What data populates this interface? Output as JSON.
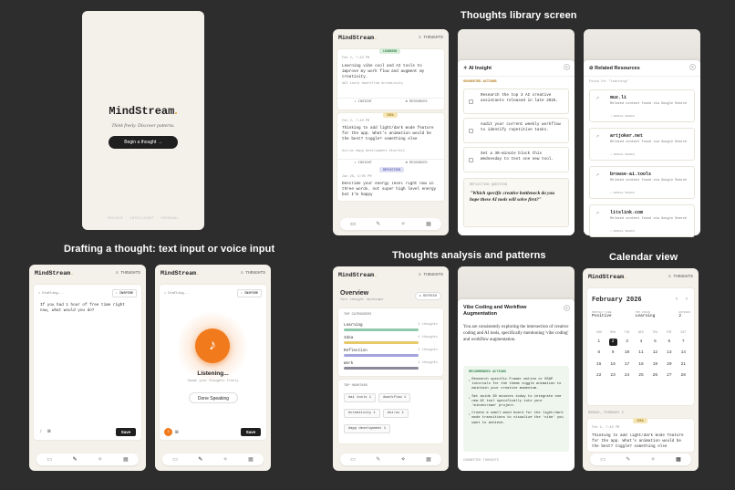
{
  "sections": {
    "library": "Thoughts library screen",
    "drafting": "Drafting a thought: text input or voice input",
    "analysis": "Thoughts analysis and patterns",
    "calendar": "Calendar view"
  },
  "brand": {
    "name": "MindStream",
    "dot": "."
  },
  "top_link": "≡ THOUGHTS",
  "splash": {
    "tagline": "Think freely. Discover patterns.",
    "cta": "Begin a thought →",
    "footer": "PRIVATE · INTELLIGENT · PERSONAL"
  },
  "library": {
    "cards": [
      {
        "tag": "LEARNING",
        "date": "Feb 2, 7:40 PM",
        "text": "Learning vibe cool and AI tools to improve my work flow and augment my creativity.",
        "meta": "#AI tools   #workflow   #creativity",
        "a1": "INSIGHT",
        "a2": "RESOURCES"
      },
      {
        "tag": "IDEA",
        "date": "Feb 2, 7:40 PM",
        "text": "Thinking to add light/dark mode feature for the app. What's animation would be the best? toggle? something else",
        "meta": "#ui/ux   #app development   #toolkit",
        "a1": "INSIGHT",
        "a2": "RESOURCES"
      },
      {
        "tag": "REFLECTION",
        "date": "Jan 28, 9:05 PM",
        "text": "Describe your energy level right now in three words. not super high level energy but I'm happy",
        "meta": "",
        "a1": "",
        "a2": ""
      }
    ]
  },
  "insight": {
    "title": "AI Insight",
    "suggested": "SUGGESTED ACTIONS",
    "actions": [
      "Research the top 3 AI creative assistants released in late 2025.",
      "Audit your current weekly workflow to identify repetitive tasks.",
      "Set a 30-minute block this Wednesday to test one new tool."
    ],
    "question_label": "REFLECTION QUESTION",
    "question": "\"Which specific creative bottleneck do you hope these AI tools will solve first?\""
  },
  "resources": {
    "title": "Related Resources",
    "found": "Found for \"Learning\"",
    "items": [
      {
        "name": "muz.li",
        "desc": "Related content found via Google Search",
        "src": "↗ GOOGLE SEARCH"
      },
      {
        "name": "artjoker.net",
        "desc": "Related content found via Google Search",
        "src": "↗ GOOGLE SEARCH"
      },
      {
        "name": "browse-ai.tools",
        "desc": "Related content found via Google Search",
        "src": "↗ GOOGLE SEARCH"
      },
      {
        "name": "litslink.com",
        "desc": "Related content found via Google Search",
        "src": "↗ GOOGLE SEARCH"
      }
    ]
  },
  "draft_text": {
    "label": "Drafting...",
    "inspire": "INSPIRE",
    "text": "If you had 1 hour of free time right now, what would you do?",
    "save": "Save"
  },
  "draft_voice": {
    "label": "Drafting...",
    "inspire": "INSPIRE",
    "listening": "Listening...",
    "hint": "Speak your thoughts freely",
    "done": "Done Speaking",
    "save": "Save"
  },
  "overview": {
    "title": "Overview",
    "subtitle": "Your thought landscape",
    "refresh": "REFRESH",
    "cat_label": "TOP CATEGORIES",
    "categories": [
      {
        "name": "Learning",
        "count": "2 thoughts",
        "color": "#8fc9a9",
        "fill": 0.8
      },
      {
        "name": "Idea",
        "count": "1 thoughts",
        "color": "#e8c96a",
        "fill": 0.8
      },
      {
        "name": "Reflection",
        "count": "1 thoughts",
        "color": "#a3a3de",
        "fill": 0.8
      },
      {
        "name": "Work",
        "count": "1 thoughts",
        "color": "#8a8a9a",
        "fill": 0.8
      }
    ],
    "hashtag_label": "TOP HASHTAGS",
    "hashtags": [
      "#ai tools 1",
      "#workflow 1",
      "#creativity 1",
      "#ui/ux 1",
      "#app development 1"
    ]
  },
  "analysis": {
    "title": "Vibe Coding and Workflow Augmentation",
    "text": "You are consistently exploring the intersection of creative coding and AI tools, specifically mentioning 'vibe coding' and workflow augmentation.",
    "rec_label": "RECOMMENDED ACTIONS",
    "actions": [
      "Research specific Framer motion or GSAP tutorials for the theme toggle animation to maintain your creative momentum.",
      "Set aside 30 minutes today to integrate one new AI tool specifically into your 'mindstream' project.",
      "Create a small mood board for the light/dark mode transitions to visualize the 'vibe' you want to achieve."
    ],
    "connected": "CONNECTED THOUGHTS"
  },
  "calendar": {
    "month": "February 2026",
    "stats": [
      {
        "label": "MONTHLY VIBE",
        "value": "Positive"
      },
      {
        "label": "TOP FOCUS",
        "value": "Learning"
      },
      {
        "label": "ENTRIES",
        "value": "2"
      }
    ],
    "weekdays": [
      "SUN",
      "MON",
      "TUE",
      "WED",
      "THU",
      "FRI",
      "SAT"
    ],
    "days": [
      "1",
      "2",
      "3",
      "4",
      "5",
      "6",
      "7",
      "8",
      "9",
      "10",
      "11",
      "12",
      "13",
      "14",
      "15",
      "16",
      "17",
      "18",
      "19",
      "20",
      "21",
      "22",
      "23",
      "24",
      "25",
      "26",
      "27",
      "28"
    ],
    "selected": "2",
    "day_label": "MONDAY, FEBRUARY 2",
    "entry_tag": "IDEA",
    "entry_date": "Feb 2, 7:40 PM",
    "entry_text": "Thinking to add light/dark mode feature for the app. What's animation would be the best? toggle? something else"
  },
  "nav_icons": [
    "book-icon",
    "pen-icon",
    "sparkle-icon",
    "calendar-icon"
  ],
  "colors": {
    "accent": "#e4a23a",
    "bg": "#2d2d2d",
    "paper": "#f4f1ea",
    "orange": "#f07a1c"
  }
}
